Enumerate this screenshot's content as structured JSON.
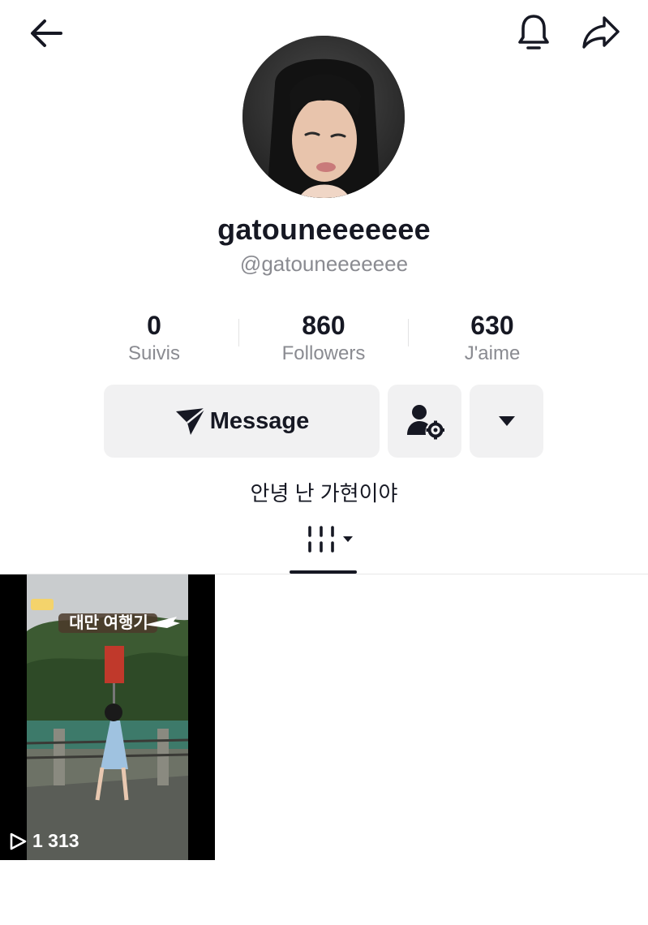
{
  "profile": {
    "display_name": "gatouneeeeeee",
    "username": "@gatouneeeeeee",
    "bio": "안녕 난 가현이야"
  },
  "stats": [
    {
      "value": "0",
      "label": "Suivis"
    },
    {
      "value": "860",
      "label": "Followers"
    },
    {
      "value": "630",
      "label": "J'aime"
    }
  ],
  "actions": {
    "message_label": "Message"
  },
  "videos": [
    {
      "overlay_title": "대만 여행기",
      "play_count": "1 313"
    }
  ],
  "icons": {
    "back": "arrow-left-icon",
    "notifications": "bell-icon",
    "share": "share-arrow-icon",
    "message": "send-icon",
    "add_friend": "user-gear-icon",
    "more": "caret-down-icon",
    "grid_tab": "grid-columns-icon",
    "play": "play-icon"
  },
  "colors": {
    "text_primary": "#161823",
    "text_secondary": "#8a8b91",
    "button_bg": "#f1f1f2"
  }
}
